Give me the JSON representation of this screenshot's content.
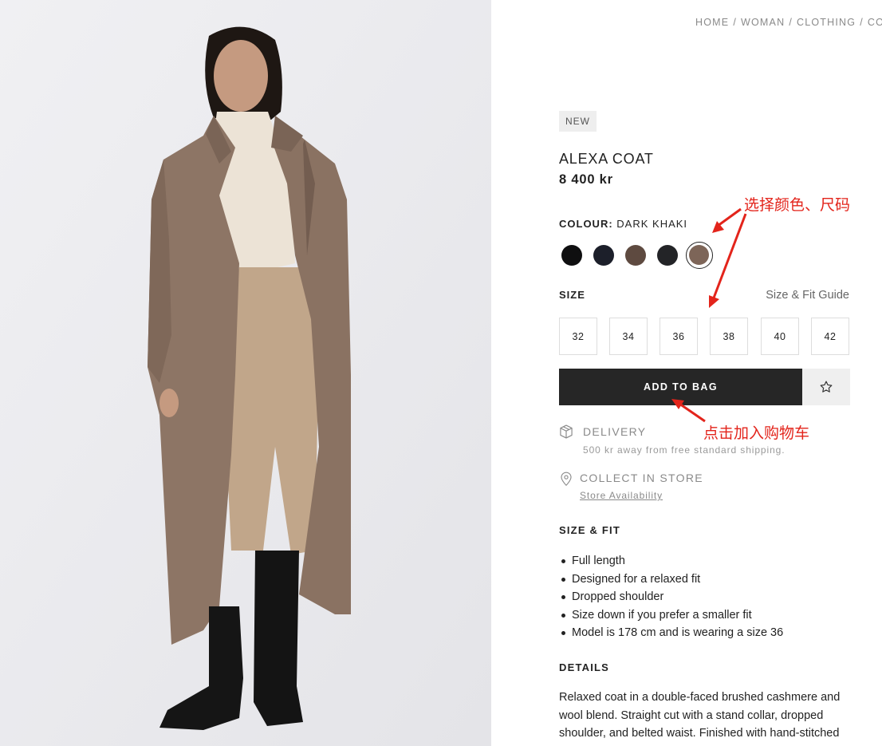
{
  "breadcrumb": [
    "HOME",
    "WOMAN",
    "CLOTHING",
    "CO"
  ],
  "product": {
    "badge": "NEW",
    "name": "ALEXA COAT",
    "price": "8 400 kr"
  },
  "colour": {
    "label": "COLOUR:",
    "selected_name": "DARK KHAKI",
    "swatches": [
      {
        "name": "black",
        "hex": "#0f0f10"
      },
      {
        "name": "dark-navy",
        "hex": "#1c1f2a"
      },
      {
        "name": "brown",
        "hex": "#5e4a40"
      },
      {
        "name": "charcoal",
        "hex": "#232427"
      },
      {
        "name": "dark-khaki",
        "hex": "#7d6558",
        "selected": true
      }
    ]
  },
  "size": {
    "label": "SIZE",
    "guide_link": "Size & Fit Guide",
    "options": [
      "32",
      "34",
      "36",
      "38",
      "40",
      "42"
    ]
  },
  "actions": {
    "add_to_bag": "ADD TO BAG",
    "wishlist_icon": "star-outline-icon"
  },
  "delivery": {
    "title": "DELIVERY",
    "subtitle": "500 kr away from free standard shipping.",
    "icon": "box-icon"
  },
  "store": {
    "title": "COLLECT IN STORE",
    "link": "Store Availability",
    "icon": "location-pin-icon"
  },
  "size_fit": {
    "heading": "SIZE & FIT",
    "items": [
      "Full length",
      "Designed for a relaxed fit",
      "Dropped shoulder",
      "Size down if you prefer a smaller fit",
      "Model is 178 cm and is wearing a size 36"
    ]
  },
  "details": {
    "heading": "DETAILS",
    "text": "Relaxed coat in a double-faced brushed cashmere and wool blend. Straight cut with a stand collar, dropped shoulder, and belted waist. Finished with hand-stitched"
  },
  "annotations": {
    "select_colour_size": "选择颜色、尺码",
    "click_add_to_cart": "点击加入购物车",
    "color": "#e3241b"
  }
}
